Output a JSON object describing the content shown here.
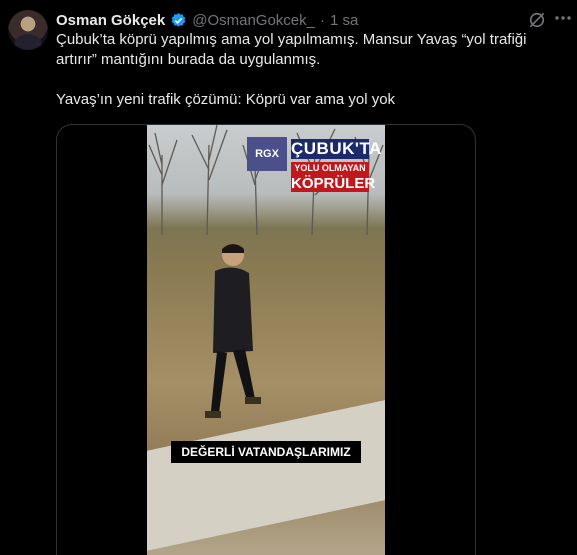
{
  "author": {
    "name": "Osman Gökçek",
    "handle": "@OsmanGokcek_",
    "separator": "·",
    "time": "1 sa"
  },
  "icons": {
    "verified": "verified-badge-icon",
    "grok": "grok-icon",
    "more": "more-options-icon"
  },
  "tweet": {
    "line1": "Çubuk’ta köprü yapılmış ama yol yapılmamış. Mansur Yavaş  “yol trafiği artırır” mantığını burada da  uygulanmış.",
    "line2": "Yavaş’ın yeni trafik çözümü: Köprü var ama yol yok"
  },
  "video": {
    "channel_logo": "RGX",
    "headline_1": "ÇUBUK'TA",
    "headline_2": "YOLU OLMAYAN",
    "headline_3": "KÖPRÜLER",
    "caption": "DEĞERLİ VATANDAŞLARIMIZ"
  },
  "colors": {
    "background": "#000000",
    "text": "#e7e9ea",
    "secondary_text": "#71767b",
    "verified_blue": "#1d9bf0",
    "headline_red": "#c0181c",
    "headline_navy": "#1c2a6b"
  }
}
